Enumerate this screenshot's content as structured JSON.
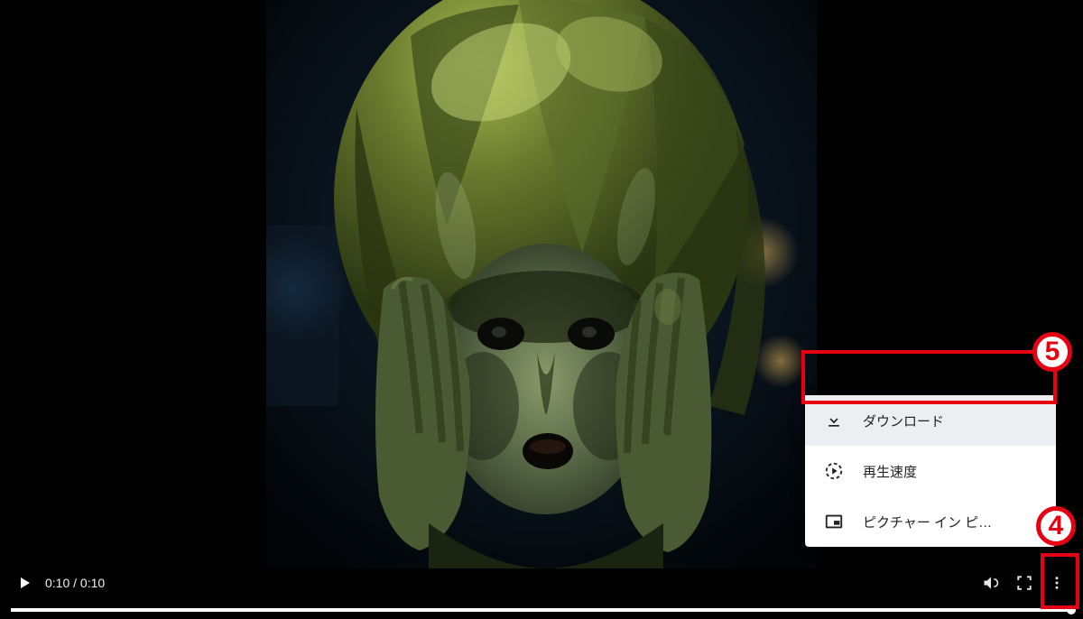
{
  "player": {
    "current_time": "0:10",
    "duration": "0:10",
    "time_display": "0:10 / 0:10"
  },
  "menu": {
    "download": "ダウンロード",
    "playback_speed": "再生速度",
    "picture_in_picture": "ピクチャー イン ピ…"
  },
  "annotations": {
    "label5": "5",
    "label4": "4"
  }
}
